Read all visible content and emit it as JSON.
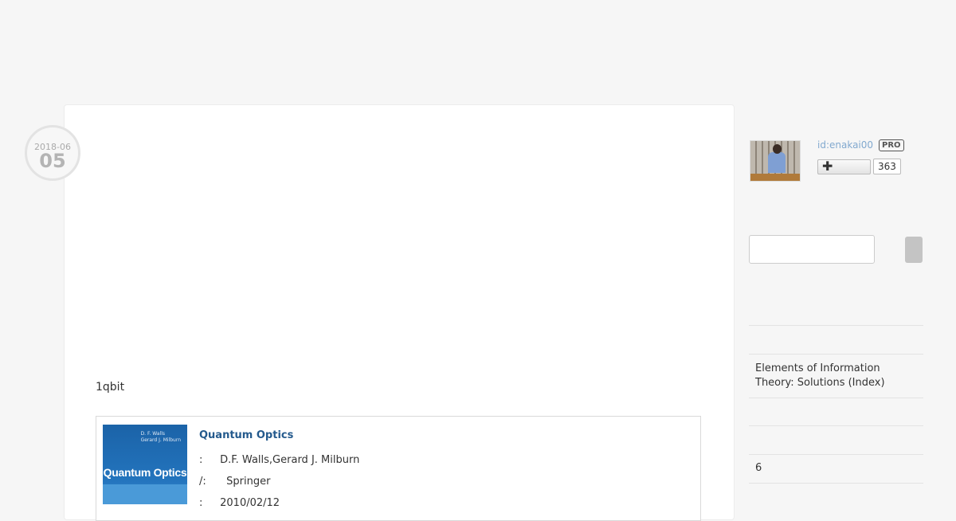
{
  "entry": {
    "date_year_month": "2018-06",
    "date_day": "05",
    "body_text": "1qbit"
  },
  "book": {
    "cover": {
      "authors_line1": "D. F. Walls",
      "authors_line2": "Gerard J. Milburn",
      "title": "Quantum Optics"
    },
    "title": "Quantum Optics",
    "meta": [
      {
        "label": ":",
        "value": "D.F. Walls,Gerard J. Milburn"
      },
      {
        "label": "/:",
        "value": "Springer"
      },
      {
        "label": ":",
        "value": "2010/02/12"
      }
    ]
  },
  "sidebar": {
    "user_id": "id:enakai00",
    "pro_badge": "PRO",
    "follow_plus": "✚",
    "follower_count": "363",
    "search": {
      "placeholder": ""
    },
    "links": [
      {
        "label": "Elements of Information Theory: Solutions (Index)"
      },
      {
        "label": "6"
      }
    ]
  }
}
